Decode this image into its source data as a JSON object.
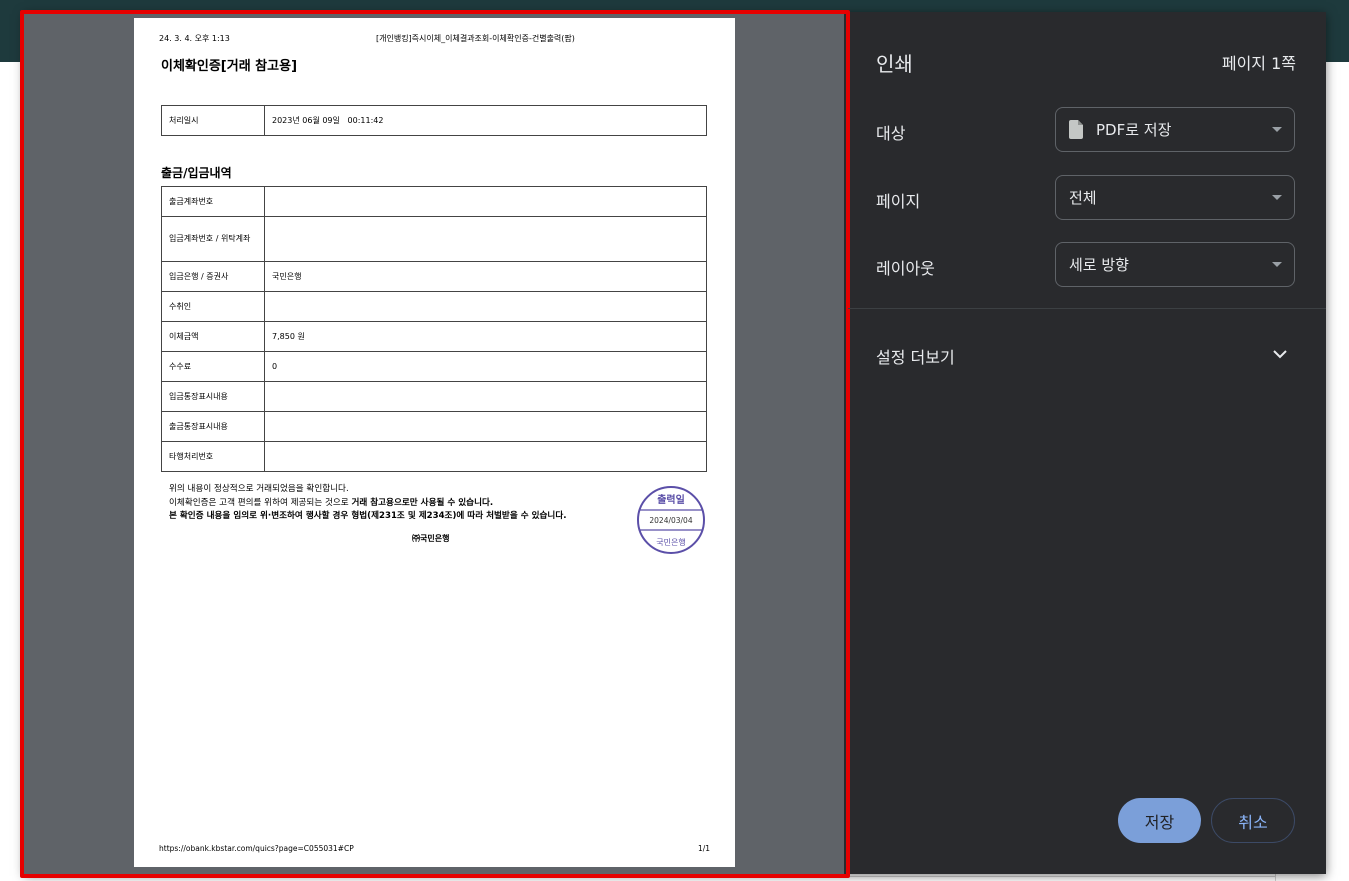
{
  "document": {
    "header_datetime": "24. 3. 4. 오후 1:13",
    "header_title": "[개인뱅킹]즉시이체_이체결과조회-이체확인증-건별출력(팝)",
    "title": "이체확인증[거래 참고용]",
    "processed_row": {
      "label": "처리일시",
      "value": "2023년 06월 09일   00:11:42"
    },
    "section_title": "출금/입금내역",
    "rows": [
      {
        "label": "출금계좌번호",
        "value": ""
      },
      {
        "label": "입금계좌번호 / 위탁계좌",
        "value": ""
      },
      {
        "label": "입금은행 / 증권사",
        "value": "국민은행"
      },
      {
        "label": "수취인",
        "value": ""
      },
      {
        "label": "이체금액",
        "value": "7,850 원"
      },
      {
        "label": "수수료",
        "value": "0"
      },
      {
        "label": "입금통장표시내용",
        "value": ""
      },
      {
        "label": "출금통장표시내용",
        "value": ""
      },
      {
        "label": "타행처리번호",
        "value": ""
      }
    ],
    "notice_line1": "위의 내용이 정상적으로 거래되었음을 확인합니다.",
    "notice_line2a": "이체확인증은 고객 편의를 위하여 제공되는 것으로 ",
    "notice_line2b": "거래 참고용으로만 사용될 수 있습니다.",
    "notice_line3": "본 확인증 내용을 임의로 위·변조하여 행사할 경우 형법(제231조 및 제234조)에 따라 처벌받을 수 있습니다.",
    "bank_name": "㈜국민은행",
    "seal": {
      "top_text": "출력일",
      "date": "2024/03/04",
      "bottom_text": "국민은행",
      "color": "#5b4fa8"
    },
    "footer_url": "https://obank.kbstar.com/quics?page=C055031#CP",
    "footer_page": "1/1"
  },
  "panel": {
    "title": "인쇄",
    "page_count": "페이지 1쪽",
    "destination_label": "대상",
    "destination_value": "PDF로 저장",
    "pages_label": "페이지",
    "pages_value": "전체",
    "layout_label": "레이아웃",
    "layout_value": "세로 방향",
    "more_settings": "설정 더보기",
    "save_button": "저장",
    "cancel_button": "취소"
  },
  "colors": {
    "panel_bg": "#292a2d",
    "preview_bg": "#5f6368",
    "accent": "#8ab4f8",
    "highlight_frame": "#e60000"
  }
}
